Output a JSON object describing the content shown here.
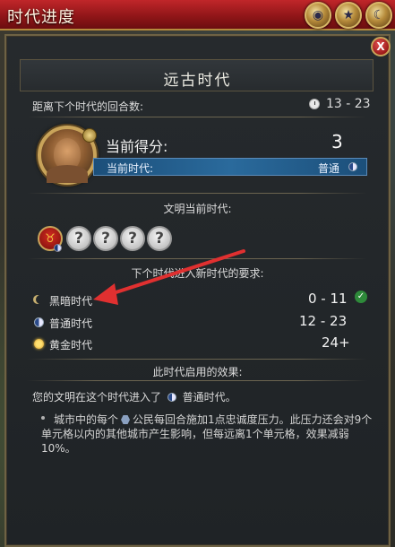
{
  "window": {
    "title": "时代进度",
    "close_label": "X"
  },
  "header": {
    "era_title": "远古时代"
  },
  "turns": {
    "label": "距离下个时代的回合数:",
    "value": "13 - 23"
  },
  "score": {
    "label": "当前得分:",
    "value": "3",
    "current_era_label": "当前时代:",
    "current_era_value": "普通"
  },
  "civs": {
    "section_title": "文明当前时代:",
    "unknown_mark": "?"
  },
  "requirements": {
    "section_title": "下个时代进入新时代的要求:",
    "items": [
      {
        "name": "黑暗时代",
        "range": "0 - 11",
        "icon": "crescent-moon-icon",
        "met": true
      },
      {
        "name": "普通时代",
        "range": "12 - 23",
        "icon": "half-moon-icon",
        "met": false
      },
      {
        "name": "黄金时代",
        "range": "24+",
        "icon": "sun-icon",
        "met": false
      }
    ]
  },
  "effects": {
    "section_title": "此时代启用的效果:",
    "intro_prefix": "您的文明在这个时代进入了",
    "intro_era": "普通时代。",
    "detail_part1": "城市中的每个",
    "detail_part2": "公民每回合施加1点忠诚度压力。此压力还会对9个单元格以内的其他城市产生影响，但每远离1个单元格，效果减弱10%。"
  },
  "colors": {
    "title_red": "#c0262a",
    "era_bar_blue": "#2a6a9c",
    "gold_border": "#c9a45a",
    "arrow_red": "#e03030",
    "check_green": "#2e8a3a"
  }
}
